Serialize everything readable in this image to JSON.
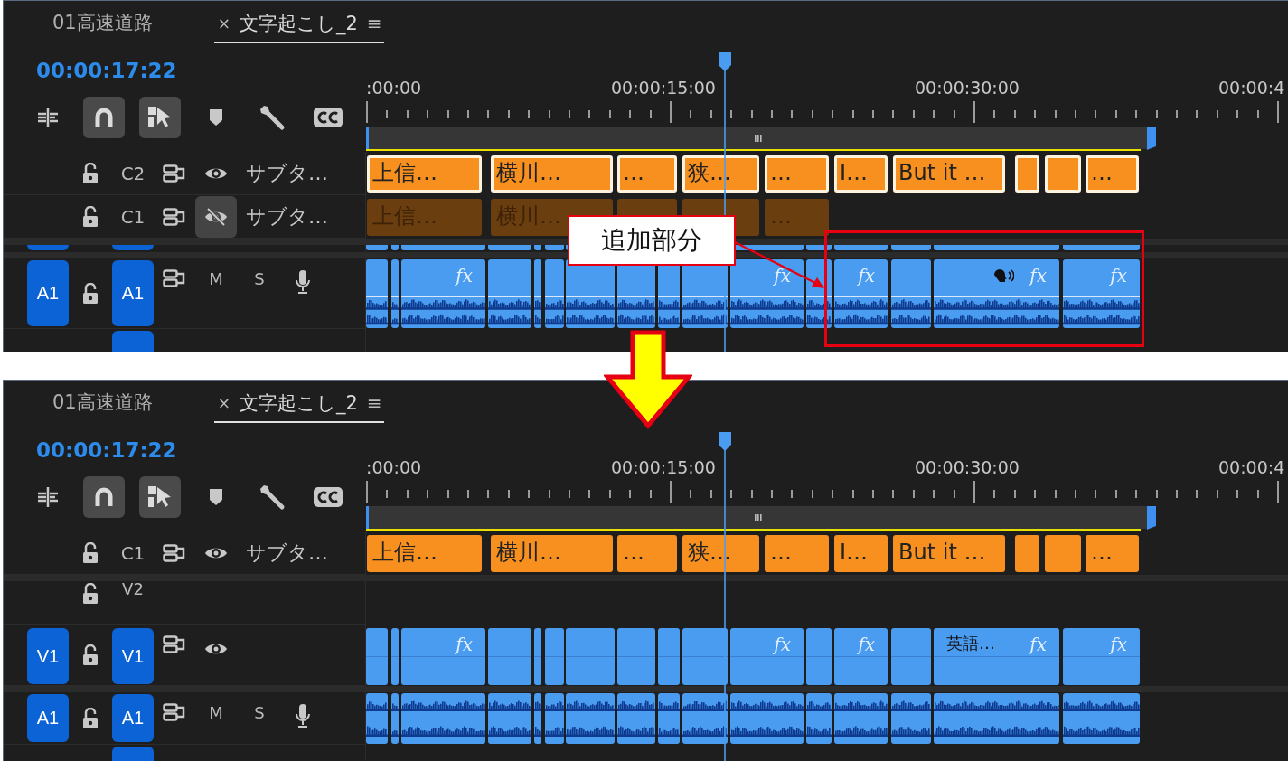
{
  "panels": [
    {
      "tabs": [
        {
          "label": "01高速道路",
          "selected": false
        },
        {
          "label": "文字起こし_2",
          "selected": true,
          "close": "×",
          "menu": "≡"
        }
      ],
      "timecode": "00:00:17:22",
      "toolbar": [
        {
          "kind": "nest",
          "on": false
        },
        {
          "kind": "snap",
          "on": true
        },
        {
          "kind": "linked",
          "on": true
        },
        {
          "kind": "marker",
          "on": false
        },
        {
          "kind": "settings",
          "on": false
        },
        {
          "kind": "captions",
          "on": false
        }
      ],
      "ruler": [
        ":00:00",
        "00:00:15:00",
        "00:00:30:00",
        "00:00:4"
      ],
      "tracks": [
        {
          "kind": "caption",
          "name": "C2",
          "visible": true,
          "title": "サブタ…",
          "clips": [
            {
              "label": "上信…",
              "selected": true
            },
            {
              "label": "横川…",
              "selected": true
            },
            {
              "label": "…",
              "selected": true
            },
            {
              "label": "狭…",
              "selected": true
            },
            {
              "label": "…",
              "selected": true
            },
            {
              "label": "I…",
              "selected": true
            },
            {
              "label": "But it …",
              "selected": true
            },
            {
              "selected": true
            },
            {
              "selected": true
            },
            {
              "label": "…",
              "selected": true
            }
          ]
        },
        {
          "kind": "caption",
          "name": "C1",
          "visible": false,
          "title": "サブタ…",
          "clips": [
            {
              "label": "上信…",
              "selected": false
            },
            {
              "label": "横川…",
              "selected": false
            },
            {
              "selected": false
            },
            {
              "selected": false
            },
            {
              "label": "…",
              "selected": false
            }
          ]
        },
        {
          "kind": "cut_top"
        },
        {
          "kind": "audio",
          "source": "A1",
          "target": "A1",
          "mute": "M",
          "solo": "S",
          "expanded": true,
          "clips": [
            {
              "kind": "plain"
            },
            {
              "kind": "plain"
            },
            {
              "kind": "effect",
              "badge": "fx"
            },
            {
              "kind": "plain"
            },
            {
              "kind": "plain"
            },
            {
              "kind": "plain"
            },
            {
              "kind": "plain"
            },
            {
              "kind": "plain"
            },
            {
              "kind": "plain"
            },
            {
              "kind": "plain"
            },
            {
              "kind": "effect",
              "badge": "fx"
            },
            {
              "kind": "plain"
            },
            {
              "kind": "effect",
              "badge": "fx"
            },
            {
              "kind": "plain"
            },
            {
              "kind": "effect",
              "badge": "fx",
              "speech": true
            },
            {
              "kind": "effect",
              "badge": "fx"
            }
          ]
        },
        {
          "kind": "cut_bottom"
        }
      ]
    },
    {
      "tabs": [
        {
          "label": "01高速道路",
          "selected": false
        },
        {
          "label": "文字起こし_2",
          "selected": true,
          "close": "×",
          "menu": "≡"
        }
      ],
      "timecode": "00:00:17:22",
      "toolbar": [
        {
          "kind": "nest",
          "on": false
        },
        {
          "kind": "snap",
          "on": true
        },
        {
          "kind": "linked",
          "on": true
        },
        {
          "kind": "marker",
          "on": false
        },
        {
          "kind": "settings",
          "on": false
        },
        {
          "kind": "captions",
          "on": false
        }
      ],
      "ruler": [
        ":00:00",
        "00:00:15:00",
        "00:00:30:00",
        "00:00:4"
      ],
      "tracks": [
        {
          "kind": "caption",
          "name": "C1",
          "visible": true,
          "title": "サブタ…",
          "clips": [
            {
              "label": "上信…",
              "selected": false
            },
            {
              "label": "横川…",
              "selected": false
            },
            {
              "label": "…",
              "selected": false
            },
            {
              "label": "狭…",
              "selected": false
            },
            {
              "label": "…",
              "selected": false
            },
            {
              "label": "I…",
              "selected": false
            },
            {
              "label": "But it …",
              "selected": false
            },
            {
              "selected": false
            },
            {
              "selected": false
            },
            {
              "label": "…",
              "selected": false
            }
          ]
        },
        {
          "kind": "partial",
          "name": "V2"
        },
        {
          "kind": "video",
          "source": "V1",
          "target": "V1",
          "visible": true,
          "clips": [
            {
              "kind": "plain"
            },
            {
              "kind": "plain"
            },
            {
              "kind": "effect",
              "badge": "fx"
            },
            {
              "kind": "plain"
            },
            {
              "kind": "plain"
            },
            {
              "kind": "plain"
            },
            {
              "kind": "plain"
            },
            {
              "kind": "plain"
            },
            {
              "kind": "plain"
            },
            {
              "kind": "plain"
            },
            {
              "kind": "effect",
              "badge": "fx"
            },
            {
              "kind": "plain"
            },
            {
              "kind": "effect",
              "badge": "fx"
            },
            {
              "kind": "plain"
            },
            {
              "kind": "effect",
              "badge": "fx",
              "label": "英語…"
            },
            {
              "kind": "effect",
              "badge": "fx"
            }
          ]
        },
        {
          "kind": "audio",
          "source": "A1",
          "target": "A1",
          "mute": "M",
          "solo": "S",
          "expanded": false,
          "clips": [
            {
              "kind": "plain"
            },
            {
              "kind": "plain"
            },
            {
              "kind": "plain"
            },
            {
              "kind": "plain"
            },
            {
              "kind": "plain"
            },
            {
              "kind": "plain"
            },
            {
              "kind": "plain"
            },
            {
              "kind": "plain"
            },
            {
              "kind": "plain"
            },
            {
              "kind": "plain"
            },
            {
              "kind": "plain"
            },
            {
              "kind": "plain"
            },
            {
              "kind": "plain"
            },
            {
              "kind": "plain"
            },
            {
              "kind": "plain"
            },
            {
              "kind": "plain"
            }
          ]
        },
        {
          "kind": "cut_bottom"
        }
      ]
    }
  ],
  "annotation": {
    "callout": "追加部分"
  }
}
